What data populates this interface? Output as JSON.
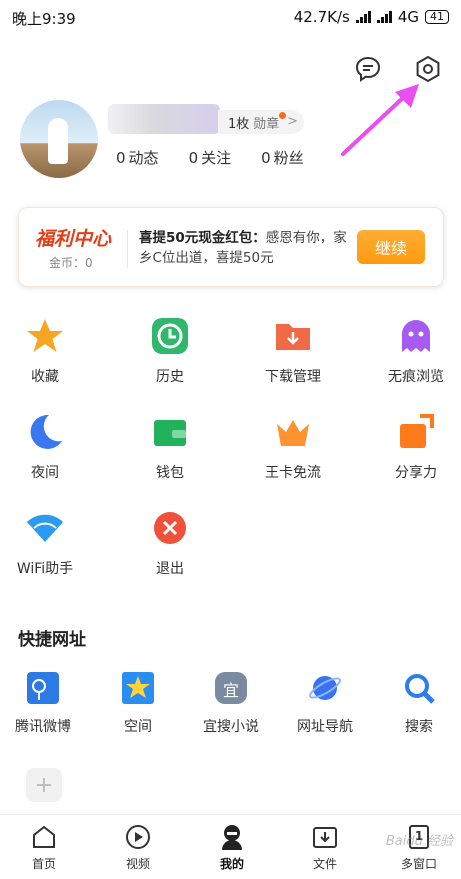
{
  "status_bar": {
    "time": "晚上9:39",
    "speed": "42.7K/s",
    "network": "4G",
    "battery": "41"
  },
  "profile": {
    "badge_count": "1枚",
    "badge_label": "勋章",
    "stats": [
      {
        "n": "0",
        "label": "动态"
      },
      {
        "n": "0",
        "label": "关注"
      },
      {
        "n": "0",
        "label": "粉丝"
      }
    ]
  },
  "promo": {
    "brand": "福利中心",
    "coins": "金币：0",
    "headline": "喜提50元现金红包：",
    "body": "感恩有你，家乡C位出道，喜提50元",
    "button": "继续"
  },
  "grid_items": [
    {
      "label": "收藏",
      "icon": "star-icon",
      "color": "#f5a623"
    },
    {
      "label": "历史",
      "icon": "clock-icon",
      "color": "#2fb86b"
    },
    {
      "label": "下载管理",
      "icon": "download-folder-icon",
      "color": "#f06a47"
    },
    {
      "label": "无痕浏览",
      "icon": "ghost-icon",
      "color": "#a65cf0"
    },
    {
      "label": "夜间",
      "icon": "moon-icon",
      "color": "#3a78f2"
    },
    {
      "label": "钱包",
      "icon": "wallet-icon",
      "color": "#22b25c"
    },
    {
      "label": "王卡免流",
      "icon": "crown-icon",
      "color": "#ff9330"
    },
    {
      "label": "分享力",
      "icon": "share-icon",
      "color": "#ff7a1a"
    },
    {
      "label": "WiFi助手",
      "icon": "wifi-icon",
      "color": "#2b9af3"
    },
    {
      "label": "退出",
      "icon": "close-circle-icon",
      "color": "#f0513a"
    }
  ],
  "quick_title": "快捷网址",
  "quick_links": [
    {
      "label": "腾讯微博",
      "icon": "weibo-icon",
      "color": "#2c7be5"
    },
    {
      "label": "空间",
      "icon": "qzone-icon",
      "color": "#2a8df0"
    },
    {
      "label": "宜搜小说",
      "icon": "yisou-icon",
      "color": "#7a8aa0",
      "glyph": "宜"
    },
    {
      "label": "网址导航",
      "icon": "planet-icon",
      "color": "#3a72f0"
    },
    {
      "label": "搜索",
      "icon": "search-icon",
      "color": "#2d7cf0"
    }
  ],
  "add_glyph": "+",
  "tabs": [
    {
      "label": "首页",
      "icon": "home-icon"
    },
    {
      "label": "视频",
      "icon": "play-icon"
    },
    {
      "label": "我的",
      "icon": "user-icon",
      "active": true
    },
    {
      "label": "文件",
      "icon": "file-download-icon"
    },
    {
      "label": "多窗口",
      "icon": "window-icon",
      "count": "1"
    }
  ],
  "watermark": "Baidu 经验"
}
